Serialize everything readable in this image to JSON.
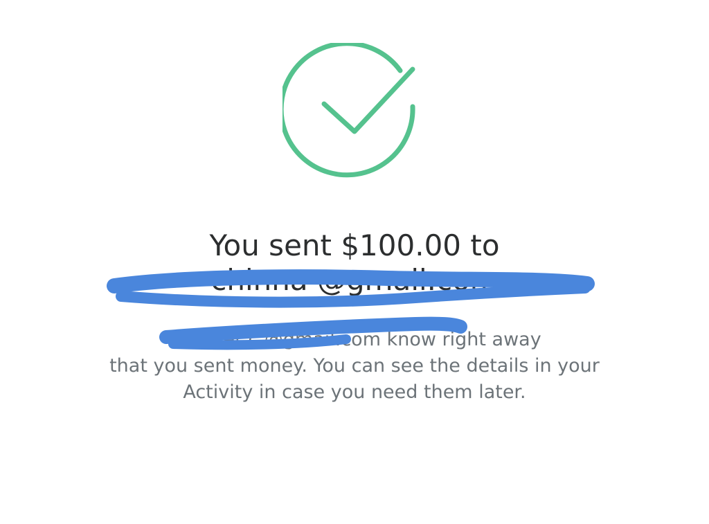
{
  "icon": {
    "name": "check-circle-icon",
    "color": "#55c28e"
  },
  "message": {
    "headline_line1": "You sent $100.00 to",
    "headline_line2": "chinna              @gmail.com",
    "body_line1": "We'll let c                @gmail.com know right away",
    "body_line2": "that you sent money. You can see the details in your",
    "body_line3": "Activity in case you need them later."
  },
  "redaction": {
    "color": "#4a86dc"
  }
}
